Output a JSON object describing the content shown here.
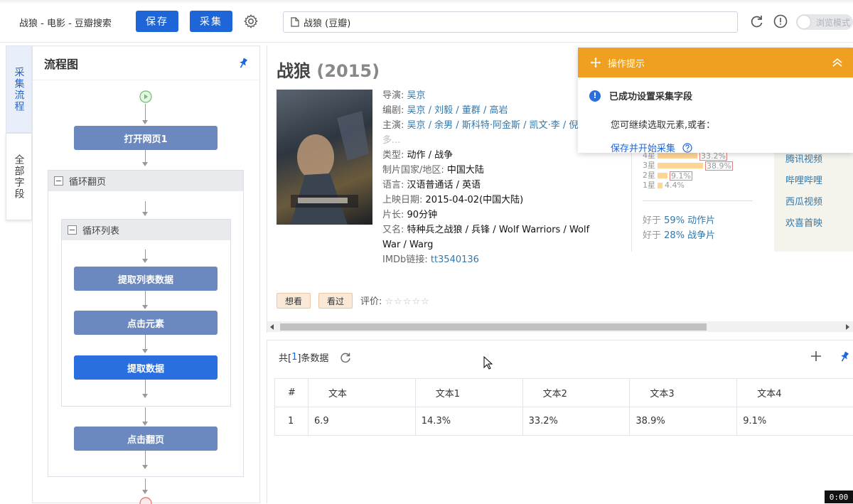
{
  "toolbar": {
    "app_title": "战狼 - 电影 - 豆瓣搜索",
    "save_label": "保存",
    "collect_label": "采集",
    "url": "战狼 (豆瓣)",
    "browse_mode_label": "浏览模式"
  },
  "side_tabs": [
    {
      "label": "采集流程"
    },
    {
      "label": "全部字段"
    }
  ],
  "flow": {
    "title": "流程图",
    "nodes": {
      "open_page": "打开网页1",
      "loop_page": "循环翻页",
      "loop_list": "循环列表",
      "extract_list": "提取列表数据",
      "click_element": "点击元素",
      "extract_data": "提取数据",
      "click_page": "点击翻页"
    }
  },
  "movie": {
    "title": "战狼",
    "year": "(2015)",
    "director_label": "导演:",
    "director": "吴京",
    "writer_label": "编剧:",
    "writers": "吴京 / 刘毅 / 董群 / 高岩",
    "cast_label": "主演:",
    "cast": "吴京 / 余男 / 斯科特·阿金斯 / 凯文·李 / 倪大",
    "more": "多...",
    "genre_label": "类型:",
    "genre": "动作 / 战争",
    "country_label": "制片国家/地区:",
    "country": "中国大陆",
    "language_label": "语言:",
    "language": "汉语普通话 / 英语",
    "release_label": "上映日期:",
    "release": "2015-04-02(中国大陆)",
    "runtime_label": "片长:",
    "runtime": "90分钟",
    "aka_label": "又名:",
    "aka": "特种兵之战狼 / 兵锋 / Wolf Warriors / Wolf War / Warg",
    "imdb_label": "IMDb链接:",
    "imdb": "tt3540136",
    "ratings": [
      {
        "label": "4星",
        "pct": "33.2%",
        "value": 33.2
      },
      {
        "label": "3星",
        "pct": "38.9%",
        "value": 38.9
      },
      {
        "label": "2星",
        "pct": "9.1%",
        "value": 9.1
      },
      {
        "label": "1星",
        "pct": "4.4%",
        "value": 4.4
      }
    ],
    "better_than": [
      {
        "prefix": "好于",
        "value": "59% 动作片"
      },
      {
        "prefix": "好于",
        "value": "28% 战争片"
      }
    ],
    "platforms": [
      "腾讯视频",
      "哔哩哔哩",
      "西瓜视频",
      "欢喜首映"
    ],
    "want_label": "想看",
    "seen_label": "看过",
    "rate_label": "评价:",
    "stars": "☆☆☆☆☆"
  },
  "tip": {
    "title": "操作提示",
    "message": "已成功设置采集字段",
    "hint": "您可继续选取元素,或者：",
    "action": "保存并开始采集"
  },
  "data": {
    "count_prefix": "共[",
    "count": "1",
    "count_suffix": "]条数据",
    "columns": [
      "#",
      "文本",
      "文本1",
      "文本2",
      "文本3",
      "文本4"
    ],
    "rows": [
      [
        "1",
        "6.9",
        "14.3%",
        "33.2%",
        "38.9%",
        "9.1%"
      ]
    ]
  },
  "timer": "0:00"
}
